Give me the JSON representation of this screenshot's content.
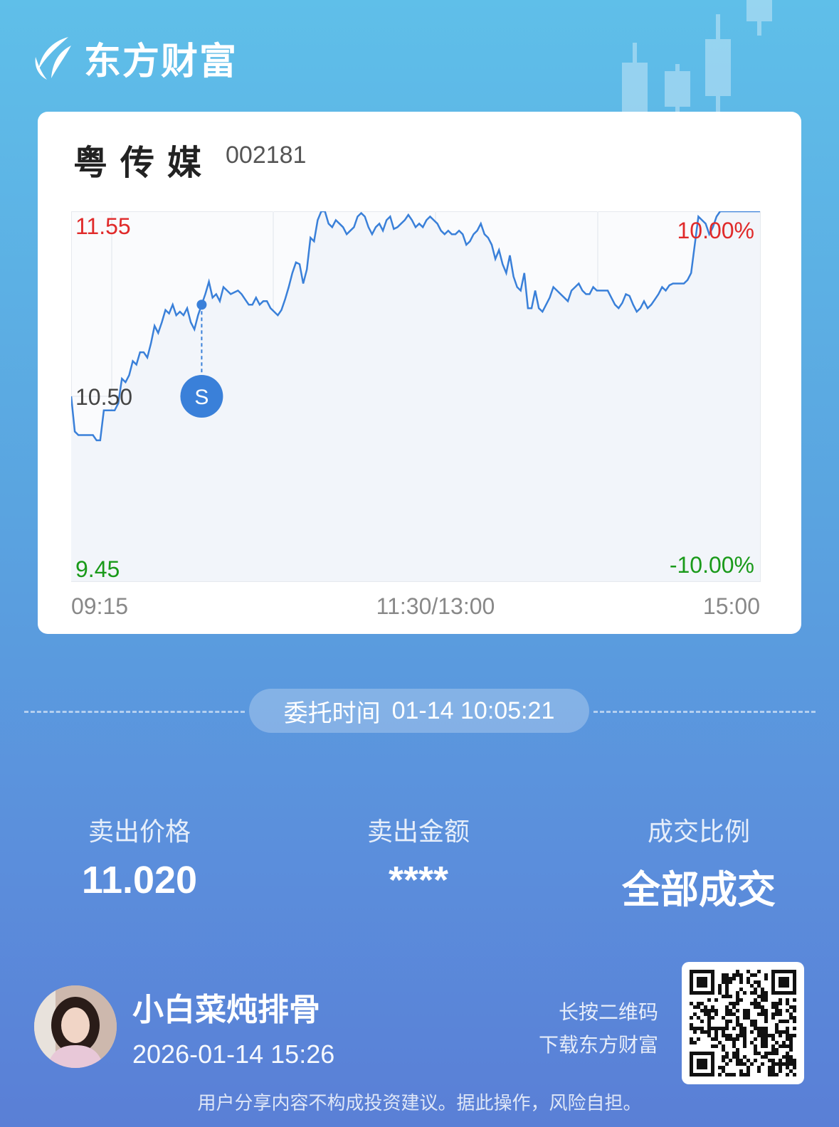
{
  "brand": {
    "name": "东方财富",
    "logo_icon": "eastmoney-logo-icon"
  },
  "stock": {
    "name": "粤传媒",
    "code": "002181"
  },
  "chart_data": {
    "type": "line",
    "title": "",
    "xlabel": "",
    "ylabel": "",
    "ylim": [
      9.45,
      11.55
    ],
    "y_labels": {
      "high": "11.55",
      "base": "10.50",
      "low": "9.45"
    },
    "pct_labels": {
      "high": "10.00%",
      "low": "-10.00%"
    },
    "x_ticks": [
      "09:15",
      "11:30/13:00",
      "15:00"
    ],
    "colors": {
      "line": "#3a80d9",
      "up": "#e02a2a",
      "down": "#1a9a1a",
      "grid": "#e6e9ee"
    },
    "series": [
      {
        "values": [
          10.5,
          10.3,
          10.28,
          10.28,
          10.28,
          10.28,
          10.28,
          10.25,
          10.25,
          10.42,
          10.42,
          10.42,
          10.42,
          10.46,
          10.6,
          10.58,
          10.62,
          10.7,
          10.68,
          10.75,
          10.75,
          10.72,
          10.8,
          10.9,
          10.86,
          10.92,
          10.99,
          10.97,
          11.02,
          10.96,
          10.98,
          10.96,
          11.0,
          10.92,
          10.88,
          10.96,
          11.02,
          11.08,
          11.15,
          11.06,
          11.08,
          11.04,
          11.12,
          11.1,
          11.08,
          11.09,
          11.1,
          11.08,
          11.05,
          11.02,
          11.02,
          11.06,
          11.02,
          11.04,
          11.04,
          11.0,
          10.98,
          10.96,
          10.99,
          11.05,
          11.12,
          11.2,
          11.26,
          11.25,
          11.14,
          11.22,
          11.4,
          11.38,
          11.5,
          11.55,
          11.55,
          11.48,
          11.46,
          11.5,
          11.48,
          11.46,
          11.42,
          11.44,
          11.46,
          11.52,
          11.54,
          11.52,
          11.46,
          11.42,
          11.46,
          11.48,
          11.44,
          11.5,
          11.52,
          11.45,
          11.46,
          11.48,
          11.5,
          11.53,
          11.5,
          11.46,
          11.48,
          11.46,
          11.5,
          11.52,
          11.5,
          11.48,
          11.44,
          11.42,
          11.44,
          11.42,
          11.42,
          11.44,
          11.42,
          11.36,
          11.38,
          11.42,
          11.44,
          11.48,
          11.42,
          11.4,
          11.36,
          11.28,
          11.33,
          11.25,
          11.2,
          11.3,
          11.18,
          11.12,
          11.1,
          11.2,
          11.0,
          11.0,
          11.1,
          11.0,
          10.98,
          11.02,
          11.06,
          11.12,
          11.1,
          11.08,
          11.06,
          11.04,
          11.1,
          11.12,
          11.14,
          11.1,
          11.08,
          11.08,
          11.12,
          11.1,
          11.1,
          11.1,
          11.1,
          11.06,
          11.02,
          11.0,
          11.03,
          11.08,
          11.07,
          11.02,
          10.98,
          11.0,
          11.04,
          11.0,
          11.02,
          11.05,
          11.08,
          11.12,
          11.1,
          11.13,
          11.14,
          11.14,
          11.14,
          11.14,
          11.16,
          11.2,
          11.36,
          11.52,
          11.5,
          11.48,
          11.42,
          11.46,
          11.52,
          11.55,
          11.55,
          11.55,
          11.55,
          11.55,
          11.55,
          11.55,
          11.55,
          11.55,
          11.55,
          11.55,
          11.55
        ]
      }
    ],
    "marker": {
      "label": "S",
      "type": "sell"
    }
  },
  "order": {
    "label": "委托时间",
    "value": "01-14 10:05:21"
  },
  "stats": [
    {
      "label": "卖出价格",
      "value": "11.020"
    },
    {
      "label": "卖出金额",
      "value": "****"
    },
    {
      "label": "成交比例",
      "value": "全部成交"
    }
  ],
  "user": {
    "name": "小白菜炖排骨",
    "date": "2026-01-14 15:26"
  },
  "qr_hint": {
    "line1": "长按二维码",
    "line2": "下载东方财富"
  },
  "disclaimer": "用户分享内容不构成投资建议。据此操作，风险自担。"
}
